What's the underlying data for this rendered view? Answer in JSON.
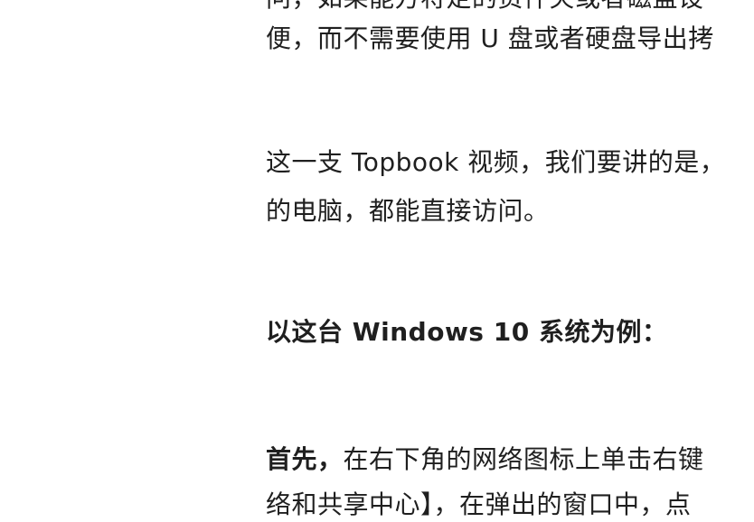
{
  "article": {
    "paragraph_1": {
      "line_1": "问，如果能方将定的资件夹或者磁盘设",
      "line_2": "便，而不需要使用 U 盘或者硬盘导出拷"
    },
    "paragraph_2": {
      "line_1": "这一支 Topbook 视频，我们要讲的是，",
      "line_2": "的电脑，都能直接访问。"
    },
    "heading": "以这台 Windows 10 系统为例：",
    "paragraph_3": {
      "lead": "首先，",
      "line_1_rest": "在右下角的网络图标上单击右键",
      "line_2": "络和共享中心】，在弹出的窗口中，点"
    }
  }
}
